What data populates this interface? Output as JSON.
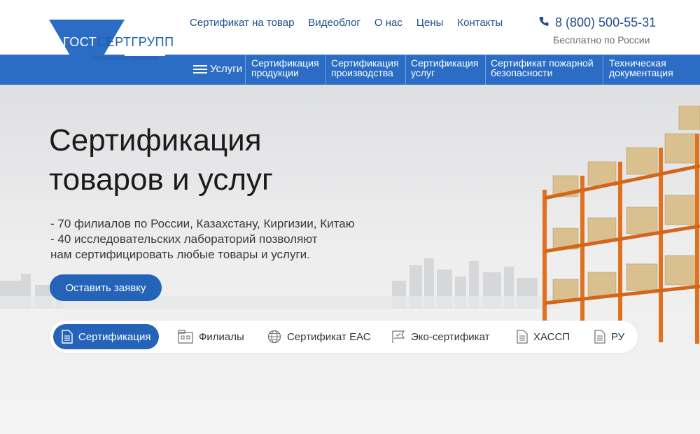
{
  "brand": {
    "name_part1": "ГОСТ",
    "name_part2": "СЕРТГРУПП",
    "tagline": "Сертификация продукции",
    "colors": {
      "primary": "#2b6cc4",
      "button": "#2563b9",
      "link": "#1f4e8c"
    }
  },
  "top_nav": [
    {
      "label": "Сертификат на товар"
    },
    {
      "label": "Видеоблог"
    },
    {
      "label": "О нас"
    },
    {
      "label": "Цены"
    },
    {
      "label": "Контакты"
    }
  ],
  "contact": {
    "phone": "8 (800) 500-55-31",
    "phone_icon": "phone-icon",
    "note": "Бесплатно по России"
  },
  "main_menu": {
    "services_label": "Услуги",
    "items": [
      {
        "line1": "Сертификация",
        "line2": "продукции"
      },
      {
        "line1": "Сертификация",
        "line2": "производства"
      },
      {
        "line1": "Сертификация",
        "line2": "услуг"
      },
      {
        "line1": "Сертификат пожарной",
        "line2": "безопасности"
      },
      {
        "line1": "Техническая",
        "line2": "документация"
      }
    ]
  },
  "hero": {
    "title_line1": "Сертификация",
    "title_line2": "товаров и услуг",
    "desc_line1": "- 70 филиалов по России, Казахстану, Киргизии, Китаю",
    "desc_line2": "- 40 исследовательских лабораторий позволяют",
    "desc_line3": "нам сертифицировать любые товары и услуги.",
    "cta_label": "Оставить заявку"
  },
  "tabs": [
    {
      "label": "Сертификация",
      "icon": "document-icon",
      "active": true
    },
    {
      "label": "Филиалы",
      "icon": "building-icon",
      "active": false
    },
    {
      "label": "Сертификат ЕАС",
      "icon": "globe-icon",
      "active": false
    },
    {
      "label": "Эко-сертификат",
      "icon": "flag-icon",
      "active": false
    },
    {
      "label": "ХАССП",
      "icon": "document-icon",
      "active": false
    },
    {
      "label": "РУ",
      "icon": "document-icon",
      "active": false
    }
  ]
}
